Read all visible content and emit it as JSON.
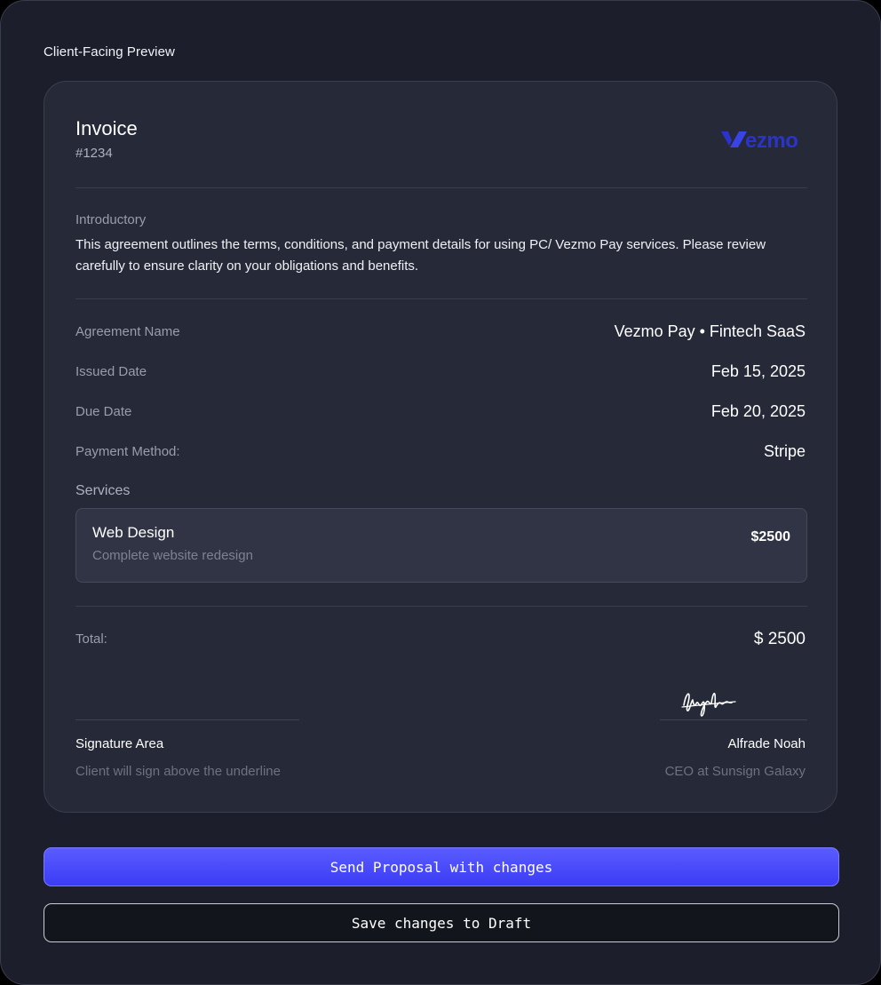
{
  "panel": {
    "title": "Client-Facing Preview"
  },
  "invoice": {
    "title": "Invoice",
    "number": "#1234",
    "logo_text": "Vezmo",
    "intro_label": "Introductory",
    "intro_text": "This agreement outlines the terms, conditions, and payment details for using PC/ Vezmo Pay services. Please review carefully to ensure clarity on your obligations and benefits.",
    "details": [
      {
        "label": "Agreement Name",
        "value": "Vezmo Pay • Fintech SaaS"
      },
      {
        "label": "Issued Date",
        "value": "Feb 15, 2025"
      },
      {
        "label": "Due Date",
        "value": "Feb 20, 2025"
      },
      {
        "label": "Payment Method:",
        "value": "Stripe"
      }
    ],
    "services_label": "Services",
    "services": [
      {
        "name": "Web Design",
        "description": "Complete website redesign",
        "price": "$2500"
      }
    ],
    "total_label": "Total:",
    "total_value": "$ 2500",
    "signature": {
      "client_title": "Signature Area",
      "client_note": "Client will sign above the underline",
      "signer_name": "Alfrade Noah",
      "signer_role": "CEO at Sunsign Galaxy"
    }
  },
  "actions": {
    "send_label": "Send Proposal with changes",
    "draft_label": "Save changes to Draft"
  },
  "colors": {
    "accent": "#4a4cff",
    "logo": "#2b33c9",
    "background": "#1c1f2b",
    "card": "#252938"
  }
}
